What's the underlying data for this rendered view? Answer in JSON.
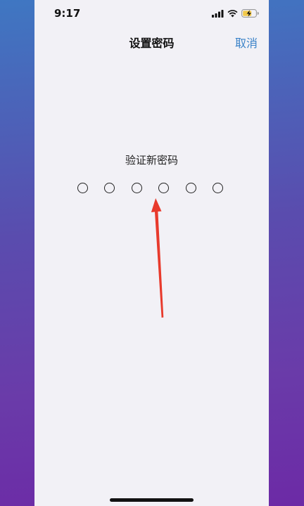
{
  "status_bar": {
    "time": "9:17",
    "icons": [
      "signal-icon",
      "wifi-icon",
      "battery-charging-icon"
    ],
    "battery_color": "#f2c94c"
  },
  "nav": {
    "title": "设置密码",
    "cancel_label": "取消",
    "accent_color": "#3a82c8"
  },
  "passcode": {
    "prompt": "验证新密码",
    "length": 6,
    "filled": 0
  },
  "annotation": {
    "icon": "red-arrow-icon",
    "color": "#e83a2c"
  }
}
